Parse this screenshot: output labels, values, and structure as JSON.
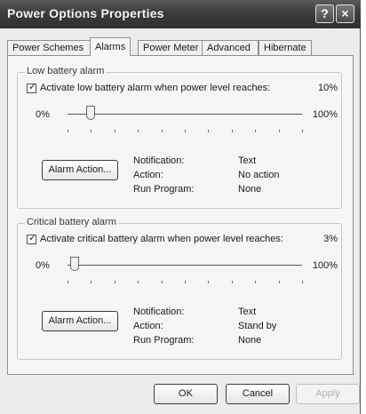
{
  "window": {
    "title": "Power Options Properties",
    "help_glyph": "?",
    "close_glyph": "×"
  },
  "tabs": [
    {
      "label": "Power Schemes",
      "active": false
    },
    {
      "label": "Alarms",
      "active": true
    },
    {
      "label": "Power Meter",
      "active": false
    },
    {
      "label": "Advanced",
      "active": false
    },
    {
      "label": "Hibernate",
      "active": false
    }
  ],
  "low_battery": {
    "group_label": "Low battery alarm",
    "checkbox_label": "Activate low battery alarm when power level reaches:",
    "checked": true,
    "value_text": "10%",
    "slider_min": "0%",
    "slider_max": "100%",
    "slider_value_pct": 10,
    "button_label": "Alarm Action...",
    "notification_label": "Notification:",
    "notification_value": "Text",
    "action_label": "Action:",
    "action_value": "No action",
    "run_program_label": "Run Program:",
    "run_program_value": "None"
  },
  "critical_battery": {
    "group_label": "Critical battery alarm",
    "checkbox_label": "Activate critical battery alarm when power level reaches:",
    "checked": true,
    "value_text": "3%",
    "slider_min": "0%",
    "slider_max": "100%",
    "slider_value_pct": 3,
    "button_label": "Alarm Action...",
    "notification_label": "Notification:",
    "notification_value": "Text",
    "action_label": "Action:",
    "action_value": "Stand by",
    "run_program_label": "Run Program:",
    "run_program_value": "None"
  },
  "footer": {
    "ok_label": "OK",
    "cancel_label": "Cancel",
    "apply_label": "Apply"
  }
}
